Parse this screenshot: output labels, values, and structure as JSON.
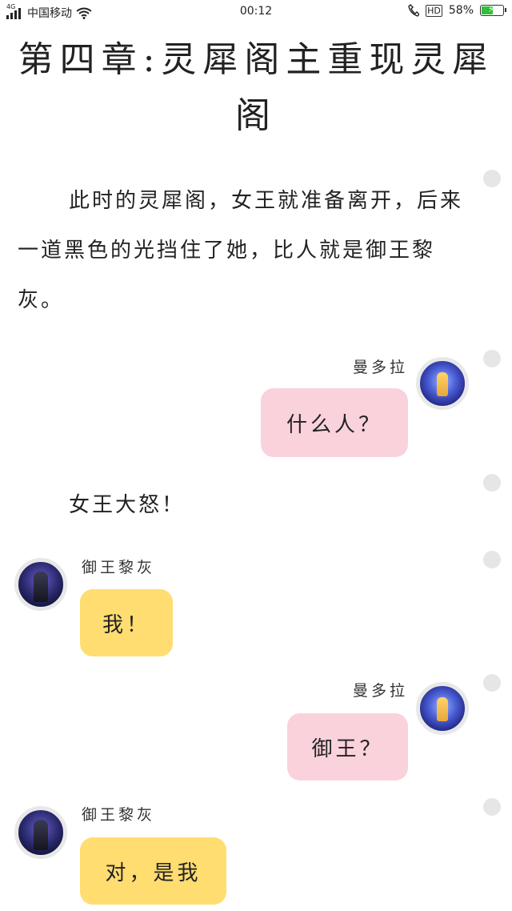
{
  "status_bar": {
    "network": "4G",
    "carrier": "中国移动",
    "time": "00:12",
    "hd_label": "HD",
    "battery_text": "58%",
    "battery_level": 0.58,
    "battery_color": "#2fbf3a"
  },
  "title": "第四章:灵犀阁主重现灵犀阁",
  "paragraphs": [
    "此时的灵犀阁，女王就准备离开，后来一道黑色的光挡住了她，比人就是御王黎灰。",
    "女王大怒！"
  ],
  "messages": [
    {
      "speaker": "曼多拉",
      "text": "什么人？",
      "side": "right",
      "bubble_color": "#fad2dc",
      "avatar": "mandora-avatar"
    },
    {
      "speaker": "御王黎灰",
      "text": "我！",
      "side": "left",
      "bubble_color": "#ffdd70",
      "avatar": "yuwang-avatar"
    },
    {
      "speaker": "曼多拉",
      "text": "御王？",
      "side": "right",
      "bubble_color": "#fad2dc",
      "avatar": "mandora-avatar"
    },
    {
      "speaker": "御王黎灰",
      "text": "对，是我",
      "side": "left",
      "bubble_color": "#ffdd70",
      "avatar": "yuwang-avatar"
    }
  ]
}
